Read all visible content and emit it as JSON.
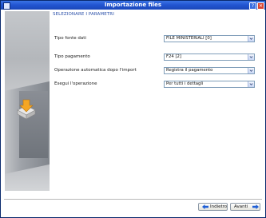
{
  "window": {
    "title": "Importazione files"
  },
  "header": {
    "section_title": "SELEZIONARE I PARAMETRI"
  },
  "form": {
    "fields": [
      {
        "label": "Tipo fonte dati",
        "value": "FILE MINISTERIALI [0]"
      },
      {
        "label": "Tipo pagamento",
        "value": "F24 [2]"
      },
      {
        "label": "Operazione automatica dopo l'import",
        "value": "Registra il pagamento"
      },
      {
        "label": "Esegui l'operazione",
        "value": "Per tutti i dettagli"
      }
    ]
  },
  "footer": {
    "back_label": "Indietro",
    "next_label": "Avanti"
  },
  "icons": {
    "title_bar": "app-icon",
    "side_panel": "upload-tray-icon",
    "dropdown": "chevron-down-icon",
    "back": "arrow-left-icon",
    "next": "arrow-right-icon"
  },
  "colors": {
    "titlebar": "#2356d2",
    "header_text": "#2a4fa8",
    "close_button": "#d8412f",
    "side_panel": "#b4b7bb",
    "arrow": "#1f5fd6"
  }
}
